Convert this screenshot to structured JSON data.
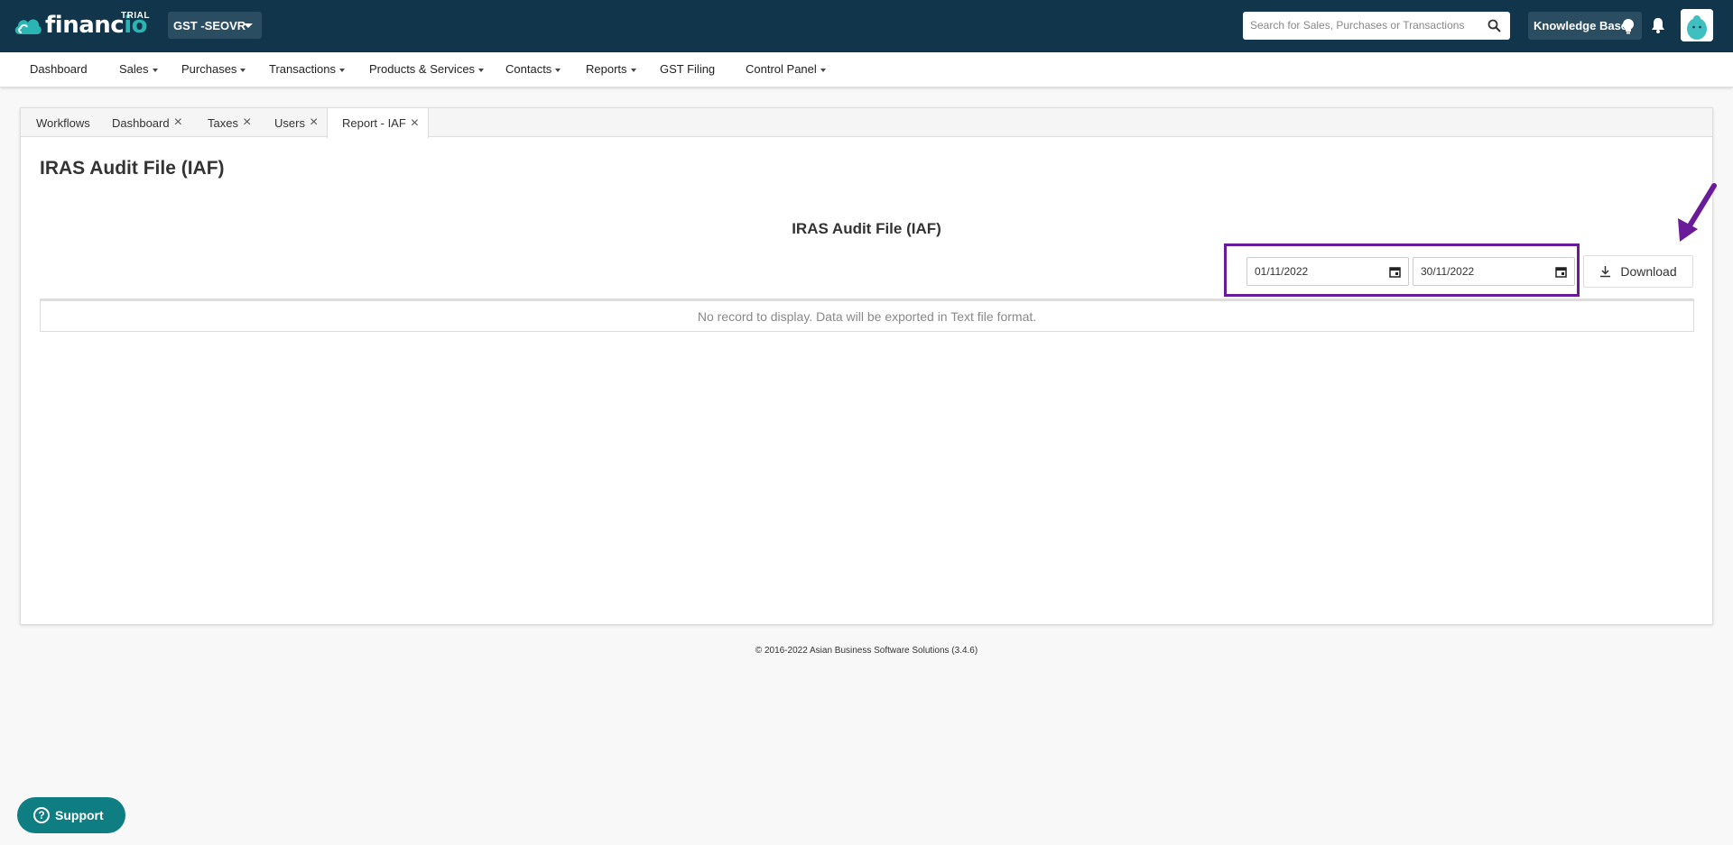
{
  "header": {
    "logo_text_a": "financ",
    "logo_text_b": "io",
    "trial_badge": "TRIAL",
    "org_name": "GST -SEOVR",
    "search_placeholder": "Search for Sales, Purchases or Transactions",
    "knowledge_base_label": "Knowledge Base",
    "brand_color": "#11364c",
    "accent_color": "#2ab5b3"
  },
  "menu": {
    "items": [
      {
        "label": "Dashboard"
      },
      {
        "label": "Sales"
      },
      {
        "label": "Purchases"
      },
      {
        "label": "Transactions"
      },
      {
        "label": "Products & Services"
      },
      {
        "label": "Contacts"
      },
      {
        "label": "Reports"
      },
      {
        "label": "GST Filing"
      },
      {
        "label": "Control Panel"
      }
    ]
  },
  "tabs": [
    {
      "label": "Workflows"
    },
    {
      "label": "Dashboard"
    },
    {
      "label": "Taxes"
    },
    {
      "label": "Users"
    },
    {
      "label": "Report - IAF"
    }
  ],
  "page": {
    "title": "IRAS Audit File (IAF)",
    "report_title": "IRAS Audit File (IAF)",
    "date_from": "01/11/2022",
    "date_to": "30/11/2022",
    "download_label": "Download",
    "empty_message": "No record to display. Data will be exported in Text file format.",
    "highlight_color": "#6a1b9a"
  },
  "footer": {
    "copyright": "© 2016-2022 Asian Business Software Solutions (3.4.6)"
  },
  "support": {
    "label": "Support"
  }
}
